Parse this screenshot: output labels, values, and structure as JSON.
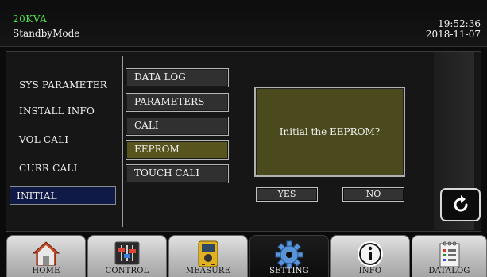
{
  "header": {
    "model": "20KVA",
    "mode": "StandbyMode",
    "time": "19:52:36",
    "date": "2018-11-07"
  },
  "side_menu": {
    "items": [
      {
        "label": "SYS PARAMETER"
      },
      {
        "label": "INSTALL INFO"
      },
      {
        "label": "VOL CALI"
      },
      {
        "label": "CURR CALI"
      },
      {
        "label": "INITIAL"
      }
    ],
    "selected": "INITIAL"
  },
  "sub_menu": {
    "items": [
      {
        "label": "DATA LOG"
      },
      {
        "label": "PARAMETERS"
      },
      {
        "label": "CALI"
      },
      {
        "label": "EEPROM"
      },
      {
        "label": "TOUCH CALI"
      }
    ],
    "selected": "EEPROM"
  },
  "dialog": {
    "message": "Initial the EEPROM?",
    "yes_label": "YES",
    "no_label": "NO"
  },
  "tabs": {
    "items": [
      {
        "label": "HOME",
        "icon": "home-icon"
      },
      {
        "label": "CONTROL",
        "icon": "sliders-icon"
      },
      {
        "label": "MEASURE",
        "icon": "meter-icon"
      },
      {
        "label": "SETTING",
        "icon": "gear-icon"
      },
      {
        "label": "INFO",
        "icon": "info-icon"
      },
      {
        "label": "DATALOG",
        "icon": "log-icon"
      }
    ],
    "active": "SETTING"
  },
  "colors": {
    "model_text": "#4ee04e",
    "selected_side_item": "#101a46",
    "selected_sub_item": "#58541e",
    "dialog_background": "#4b4a1c"
  }
}
